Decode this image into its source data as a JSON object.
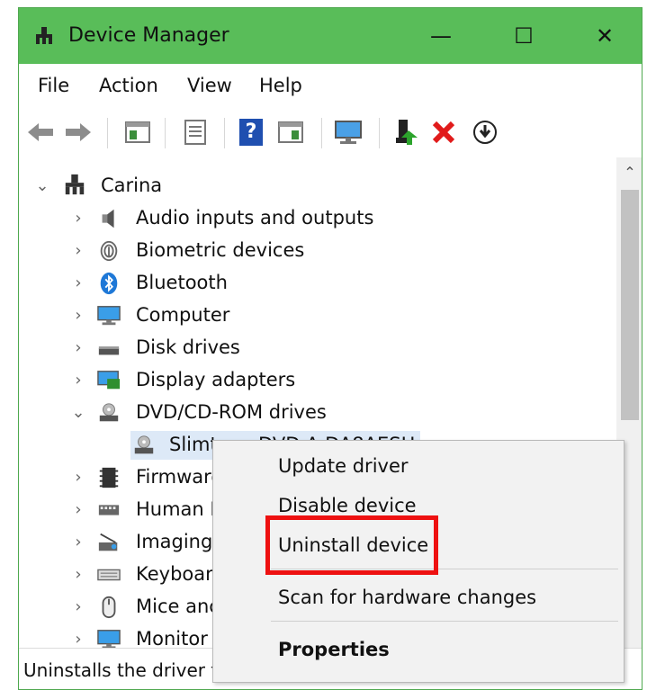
{
  "window": {
    "title": "Device Manager",
    "minimize": "—",
    "maximize": "☐",
    "close": "✕"
  },
  "menu": {
    "file": "File",
    "action": "Action",
    "view": "View",
    "help": "Help"
  },
  "toolbar": {
    "help_icon_text": "?"
  },
  "tree": {
    "root": "Carina",
    "items": [
      "Audio inputs and outputs",
      "Biometric devices",
      "Bluetooth",
      "Computer",
      "Disk drives",
      "Display adapters",
      "DVD/CD-ROM drives",
      "Slimtype DVD A DA8AESH",
      "Firmware",
      "Human I",
      "Imaging",
      "Keyboar",
      "Mice anc",
      "Monitor"
    ]
  },
  "context_menu": {
    "update": "Update driver",
    "disable": "Disable device",
    "uninstall": "Uninstall device",
    "scan": "Scan for hardware changes",
    "properties": "Properties"
  },
  "status": {
    "text": "Uninstalls the driver for"
  },
  "colors": {
    "titlebar": "#59bd59",
    "highlight": "#ee1111",
    "selection": "#dde9f7",
    "icon_blue": "#1e78d7"
  }
}
